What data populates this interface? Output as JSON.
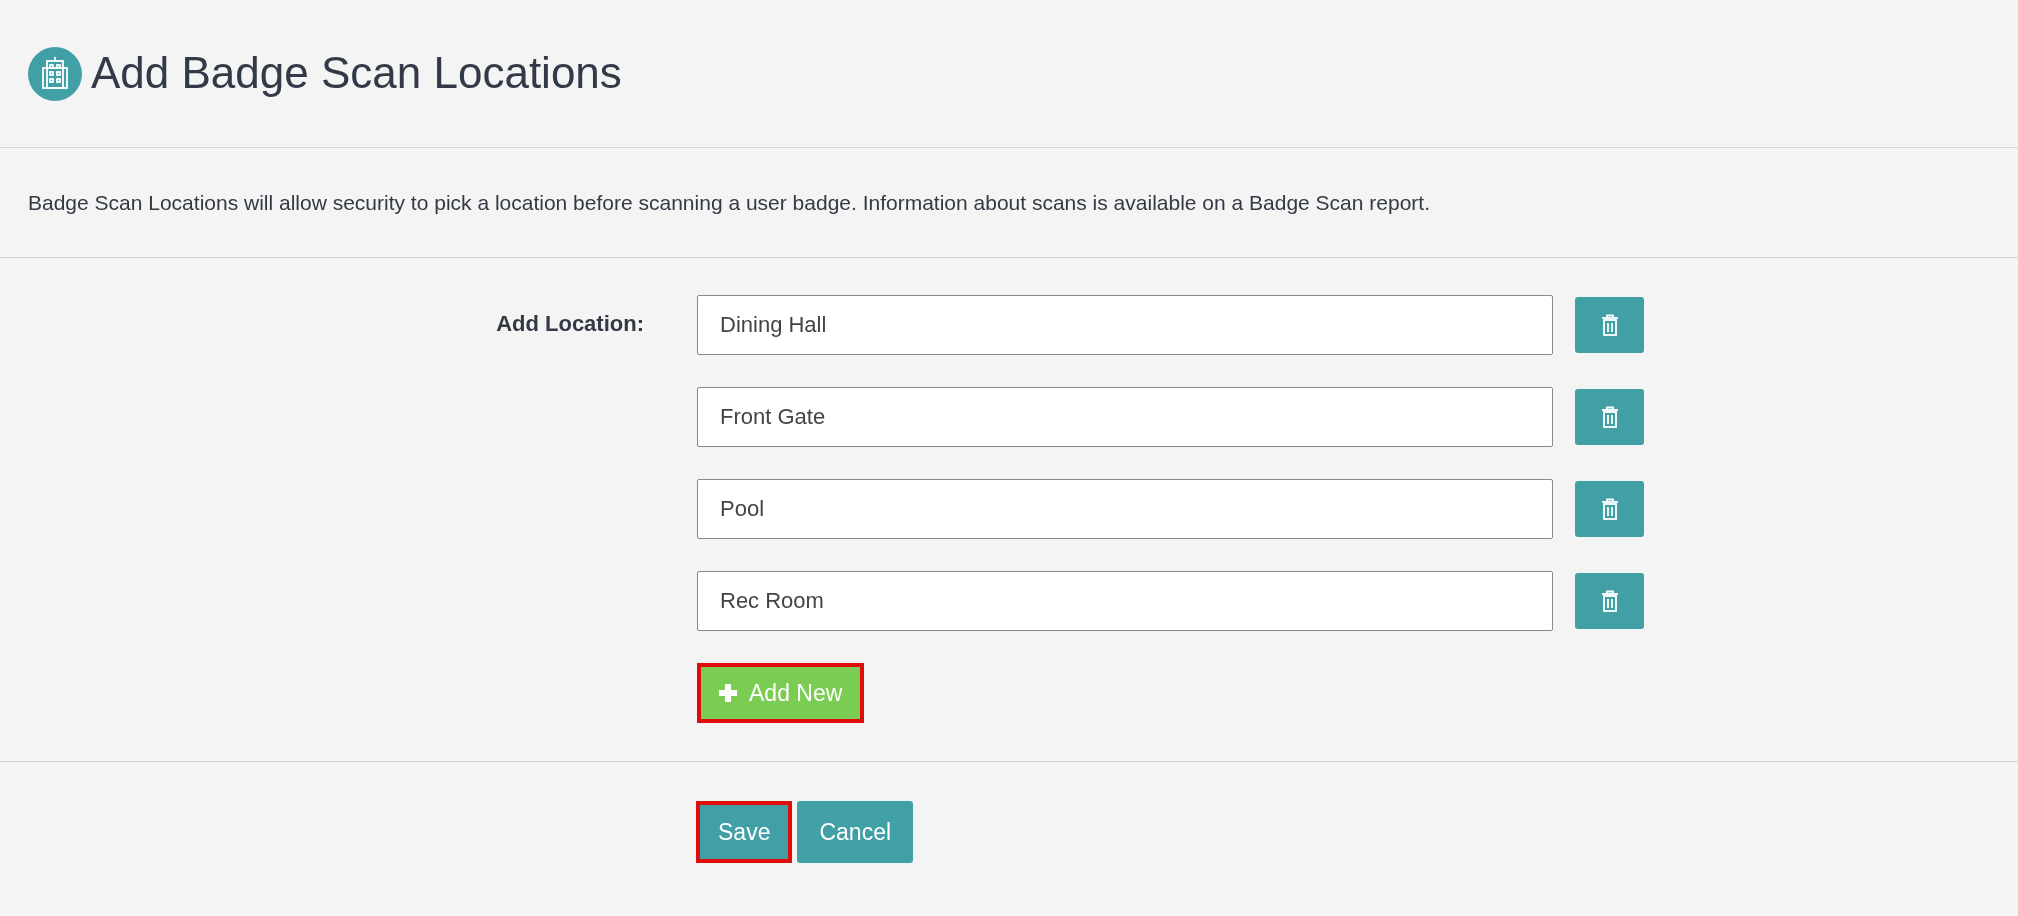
{
  "header": {
    "title": "Add Badge Scan Locations"
  },
  "description": "Badge Scan Locations will allow security to pick a location before scanning a user badge. Information about scans is available on a Badge Scan report.",
  "form": {
    "label": "Add Location:",
    "locations": [
      {
        "value": "Dining Hall"
      },
      {
        "value": "Front Gate"
      },
      {
        "value": "Pool"
      },
      {
        "value": "Rec Room"
      }
    ],
    "add_button": {
      "label": "Add New",
      "highlighted": true
    }
  },
  "actions": [
    {
      "label": "Save",
      "highlighted": true
    },
    {
      "label": "Cancel",
      "highlighted": false
    }
  ]
}
